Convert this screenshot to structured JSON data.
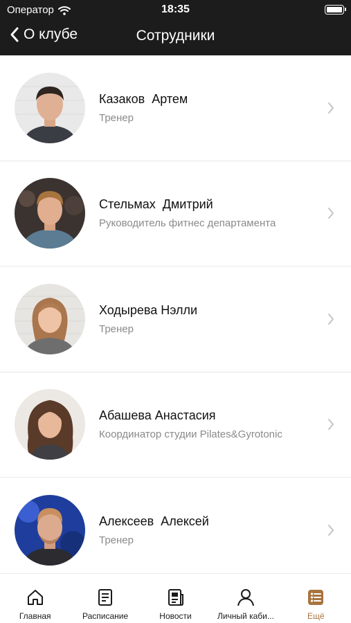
{
  "status_bar": {
    "carrier": "Оператор",
    "time": "18:35"
  },
  "nav": {
    "back_label": "О клубе",
    "title": "Сотрудники"
  },
  "staff": [
    {
      "name": "Казаков  Артем",
      "role": "Тренер"
    },
    {
      "name": "Стельмах  Дмитрий",
      "role": "Руководитель фитнес департамента"
    },
    {
      "name": "Ходырева Нэлли",
      "role": "Тренер"
    },
    {
      "name": "Абашева Анастасия",
      "role": "Координатор студии Pilates&Gyrotonic"
    },
    {
      "name": "Алексеев  Алексей",
      "role": "Тренер"
    }
  ],
  "tabs": [
    {
      "label": "Главная",
      "icon": "home-icon"
    },
    {
      "label": "Расписание",
      "icon": "schedule-icon"
    },
    {
      "label": "Новости",
      "icon": "news-icon"
    },
    {
      "label": "Личный каби...",
      "icon": "profile-icon"
    },
    {
      "label": "Ещё",
      "icon": "more-icon",
      "active": true
    }
  ],
  "colors": {
    "header_bg": "#1c1c1c",
    "accent": "#a8743e",
    "secondary_text": "#8a8a8a"
  }
}
